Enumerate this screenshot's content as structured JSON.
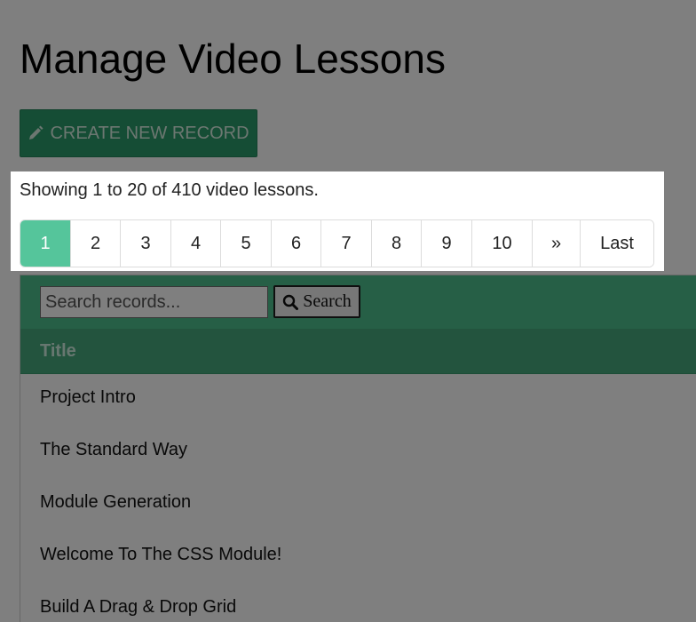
{
  "page": {
    "title": "Manage Video Lessons"
  },
  "toolbar": {
    "create_label": "CREATE NEW RECORD"
  },
  "summary": {
    "text": "Showing 1 to 20 of 410 video lessons."
  },
  "pagination": {
    "current": "1",
    "pages": [
      "1",
      "2",
      "3",
      "4",
      "5",
      "6",
      "7",
      "8",
      "9",
      "10"
    ],
    "next_label": "»",
    "last_label": "Last"
  },
  "search": {
    "placeholder": "Search records...",
    "button_label": "Search"
  },
  "table": {
    "columns": [
      "Title"
    ],
    "rows": [
      "Project Intro",
      "The Standard Way",
      "Module Generation",
      "Welcome To The CSS Module!",
      "Build A Drag & Drop Grid"
    ]
  },
  "icons": {
    "create": "pencil-icon",
    "search": "search-icon"
  },
  "colors": {
    "accent": "#4dbf8c",
    "button": "#2b9a6a",
    "active_page": "#55c59b"
  }
}
